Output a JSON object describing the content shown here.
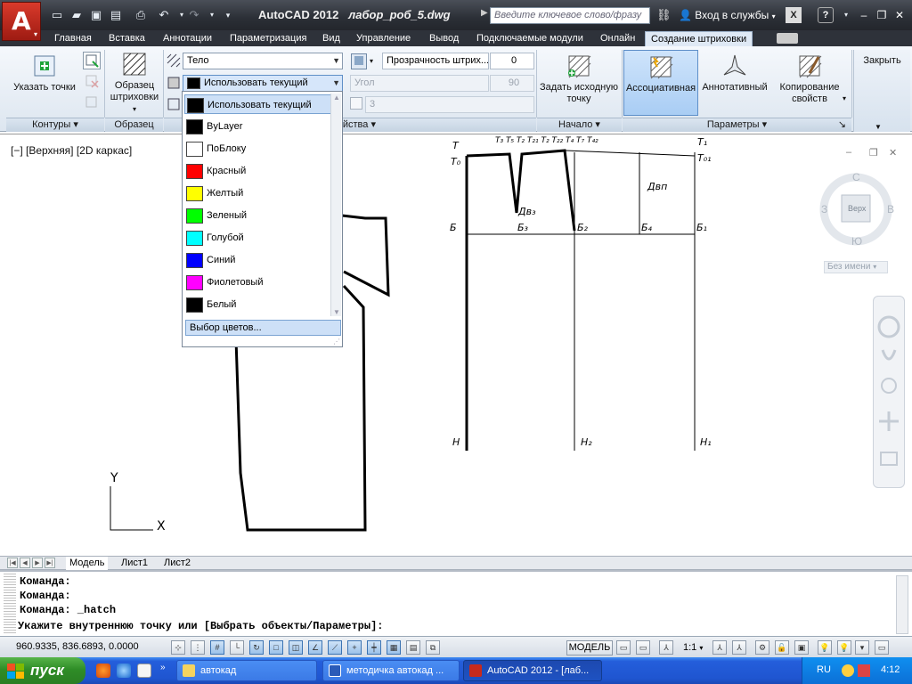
{
  "title": {
    "app_name": "AutoCAD 2012",
    "file_name": "лабор_роб_5.dwg",
    "search_placeholder": "Введите ключевое слово/фразу",
    "login": "Вход в службы"
  },
  "tabs": [
    "Главная",
    "Вставка",
    "Аннотации",
    "Параметризация",
    "Вид",
    "Управление",
    "Вывод",
    "Подключаемые модули",
    "Онлайн",
    "Создание штриховки"
  ],
  "ribbon": {
    "pick_points": "Указать точки",
    "pattern": "Образец штриховки",
    "type_value": "Тело",
    "color_value": "Использовать текущий",
    "transparency_label": "Прозрачность штрих...",
    "transparency_value": "0",
    "angle_label": "Угол",
    "angle_value": "90",
    "scale_value": "3",
    "set_origin": "Задать исходную точку",
    "associative": "Ассоциативная",
    "annotative": "Аннотативный",
    "match_props": "Копирование свойств",
    "close_label": "Закрыть",
    "panel_boundaries": "Контуры",
    "panel_pattern": "Образец",
    "panel_properties": "Свойства",
    "panel_origin": "Начало",
    "panel_options": "Параметры"
  },
  "color_dropdown": {
    "items": [
      {
        "label": "Использовать текущий",
        "color": "#000000"
      },
      {
        "label": "ByLayer",
        "color": "#000000"
      },
      {
        "label": "ПоБлоку",
        "color": "#ffffff"
      },
      {
        "label": "Красный",
        "color": "#ff0000"
      },
      {
        "label": "Желтый",
        "color": "#ffff00"
      },
      {
        "label": "Зеленый",
        "color": "#00ff00"
      },
      {
        "label": "Голубой",
        "color": "#00ffff"
      },
      {
        "label": "Синий",
        "color": "#0000ff"
      },
      {
        "label": "Фиолетовый",
        "color": "#ff00ff"
      },
      {
        "label": "Белый",
        "color": "#000000"
      }
    ],
    "more": "Выбор цветов..."
  },
  "viewport": {
    "label": "[−] [Верхняя] [2D каркас]",
    "cube_top": "Верх",
    "compass_n": "С",
    "compass_s": "Ю",
    "compass_w": "З",
    "compass_e": "В",
    "ucs_name": "Без имени"
  },
  "drawing_labels": {
    "T": "Т",
    "T0": "Т₀",
    "T01": "Т₀₁",
    "T1": "Т₁",
    "B": "Б",
    "B3": "Б₃",
    "B2": "Б₂",
    "B4": "Б₄",
    "B1": "Б₁",
    "Dvz": "Дв₃",
    "Dvp": "Двп",
    "N": "Н",
    "N2": "Н₂",
    "N1": "Н₁",
    "top_marks": "Т₃ Т₅ Т₂   Т₂₁ Т₂ Т₂₂   Т₄ Т₇ Т₄₂",
    "ucs_x": "X",
    "ucs_y": "Y"
  },
  "layout_tabs": [
    "Модель",
    "Лист1",
    "Лист2"
  ],
  "command_history": [
    "Команда:",
    "Команда:",
    "Команда: _hatch",
    "Укажите внутреннюю точку или [Выбрать объекты/Параметры]:"
  ],
  "status": {
    "coords": "960.9335, 836.6893, 0.0000",
    "model": "МОДЕЛЬ",
    "scale": "1:1"
  },
  "taskbar": {
    "start": "пуск",
    "tasks": [
      "автокад",
      "методичка автокад ...",
      "AutoCAD 2012 - [лаб..."
    ],
    "lang": "RU",
    "clock": "4:12"
  }
}
